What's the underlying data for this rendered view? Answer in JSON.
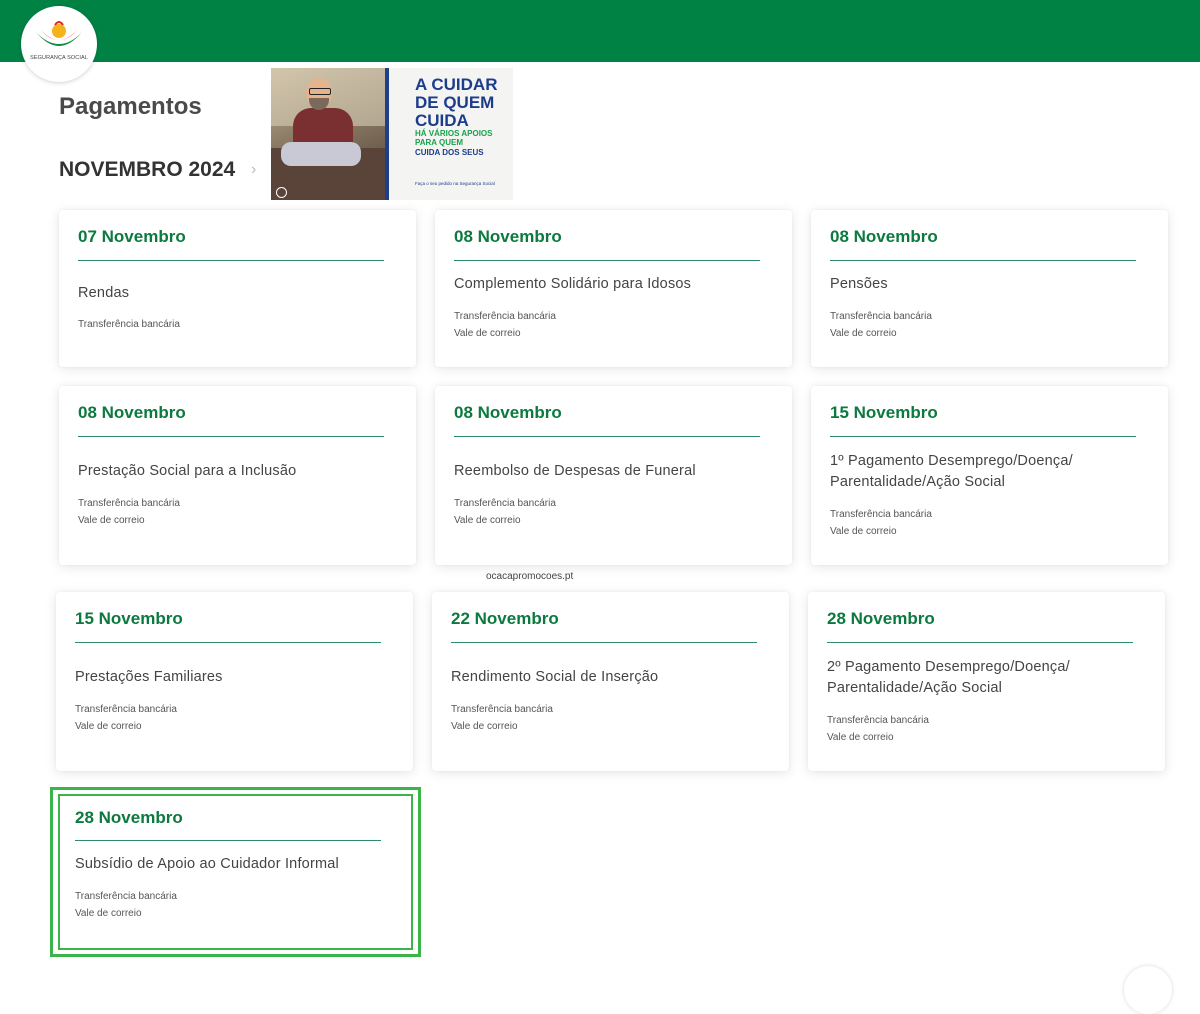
{
  "header": {
    "logo_text": "SEGURANÇA SOCIAL"
  },
  "page": {
    "title": "Pagamentos",
    "month": "NOVEMBRO 2024",
    "month_arrow": "›"
  },
  "banner": {
    "headline": "A CUIDAR DE QUEM CUIDA",
    "subheadline_green": "HÁ VÁRIOS APOIOS PARA QUEM",
    "subheadline_blue": "CUIDA DOS SEUS",
    "footer": "Faça o seu pedido na Segurança Social"
  },
  "watermark": "ocacapromocoes.pt",
  "cards": [
    {
      "date": "07 Novembro",
      "name": "Rendas",
      "methods": [
        "Transferência bancária"
      ]
    },
    {
      "date": "08 Novembro",
      "name": "Complemento Solidário para Idosos",
      "methods": [
        "Transferência bancária",
        "Vale de correio"
      ]
    },
    {
      "date": "08 Novembro",
      "name": "Pensões",
      "methods": [
        "Transferência bancária",
        "Vale de correio"
      ]
    },
    {
      "date": "08 Novembro",
      "name": "Prestação Social para a Inclusão",
      "methods": [
        "Transferência bancária",
        "Vale de correio"
      ]
    },
    {
      "date": "08 Novembro",
      "name": "Reembolso de Despesas de Funeral",
      "methods": [
        "Transferência bancária",
        "Vale de correio"
      ]
    },
    {
      "date": "15 Novembro",
      "name": "1º Pagamento Desemprego/Doença/ Parentalidade/Ação Social",
      "methods": [
        "Transferência bancária",
        "Vale de correio"
      ]
    },
    {
      "date": "15 Novembro",
      "name": "Prestações Familiares",
      "methods": [
        "Transferência bancária",
        "Vale de correio"
      ]
    },
    {
      "date": "22 Novembro",
      "name": "Rendimento Social de Inserção",
      "methods": [
        "Transferência bancária",
        "Vale de correio"
      ]
    },
    {
      "date": "28 Novembro",
      "name": "2º Pagamento Desemprego/Doença/ Parentalidade/Ação Social",
      "methods": [
        "Transferência bancária",
        "Vale de correio"
      ]
    },
    {
      "date": "28 Novembro",
      "name": "Subsídio de Apoio ao Cuidador Informal",
      "methods": [
        "Transferência bancária",
        "Vale de correio"
      ]
    }
  ],
  "colors": {
    "brand_green": "#008245",
    "date_green": "#0c7a3e",
    "highlight_green": "#3bb54a",
    "banner_blue": "#1d3d8c"
  }
}
